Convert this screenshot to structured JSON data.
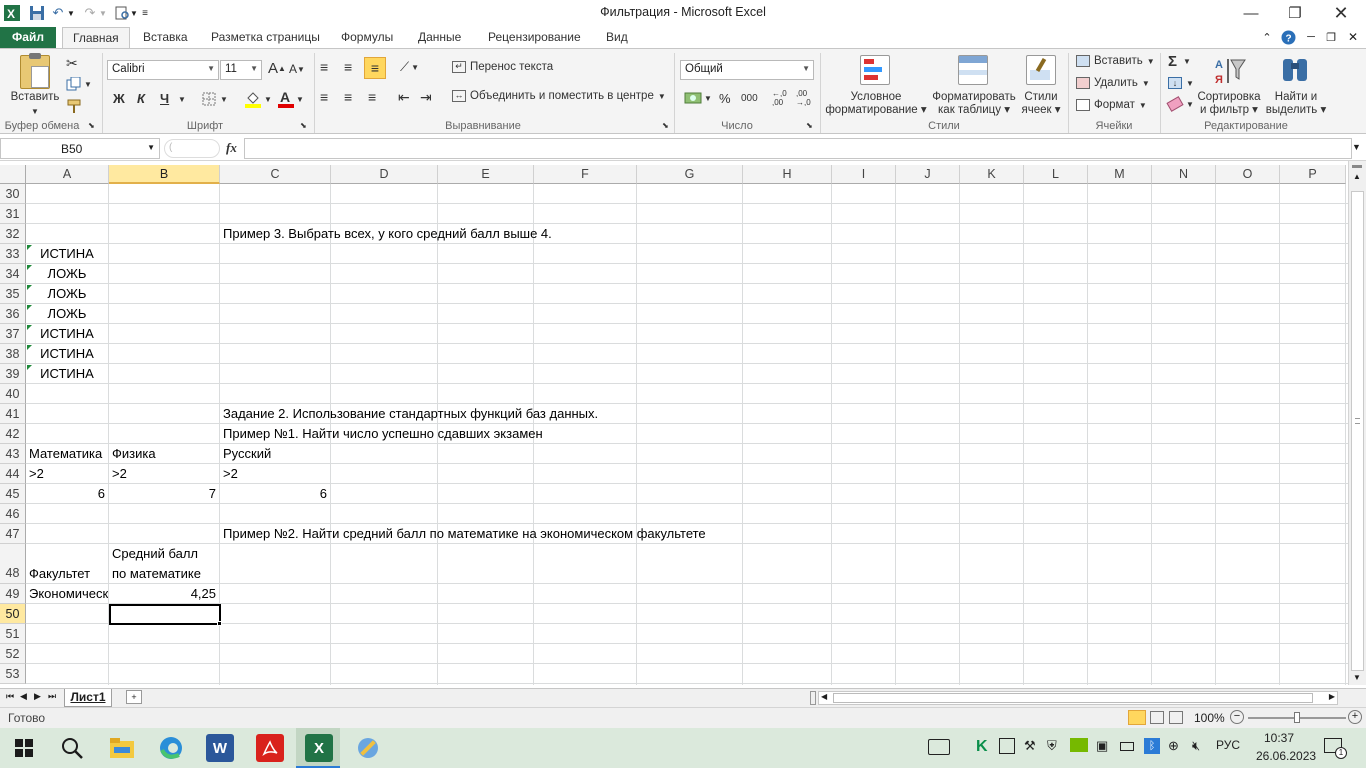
{
  "window": {
    "title": "Фильтрация  -  Microsoft Excel"
  },
  "qat": {
    "save": "save-icon",
    "undo": "undo-icon",
    "redo": "redo-icon",
    "print": "print-preview-icon"
  },
  "menu": {
    "file": "Файл",
    "tabs": [
      "Главная",
      "Вставка",
      "Разметка страницы",
      "Формулы",
      "Данные",
      "Рецензирование",
      "Вид"
    ]
  },
  "ribbon": {
    "clipboard": {
      "label": "Буфер обмена",
      "paste": "Вставить"
    },
    "font": {
      "label": "Шрифт",
      "name": "Calibri",
      "size": "11",
      "bold": "Ж",
      "italic": "К",
      "underline": "Ч",
      "grow": "A",
      "shrink": "A",
      "color": "A"
    },
    "alignment": {
      "label": "Выравнивание",
      "wrap": "Перенос текста",
      "merge": "Объединить и поместить в центре"
    },
    "number": {
      "label": "Число",
      "format": "Общий",
      "percent": "%",
      "thousands": "000",
      "inc": ",0\n,00",
      "dec": ",00\n,0"
    },
    "styles": {
      "label": "Стили",
      "conditional": "Условное\nформатирование",
      "astable": "Форматировать\nкак таблицу",
      "cellstyles": "Стили\nячеек"
    },
    "cells": {
      "label": "Ячейки",
      "insert": "Вставить",
      "delete": "Удалить",
      "format": "Формат"
    },
    "editing": {
      "label": "Редактирование",
      "sum": "Σ",
      "sort": "Сортировка\nи фильтр",
      "find": "Найти и\nвыделить"
    }
  },
  "formula_bar": {
    "name_box": "B50",
    "fx": "fx",
    "content": ""
  },
  "grid": {
    "columns": [
      "A",
      "B",
      "C",
      "D",
      "E",
      "F",
      "G",
      "H",
      "I",
      "J",
      "K",
      "L",
      "M",
      "N",
      "O",
      "P"
    ],
    "selected_column": "B",
    "selected_row": "50",
    "rows": [
      "30",
      "31",
      "32",
      "33",
      "34",
      "35",
      "36",
      "37",
      "38",
      "39",
      "40",
      "41",
      "42",
      "43",
      "44",
      "45",
      "46",
      "47",
      "48",
      "49",
      "50",
      "51",
      "52",
      "53"
    ],
    "cells": {
      "C32": "Пример 3. Выбрать всех, у кого средний балл выше 4.",
      "A33": "ИСТИНА",
      "A34": "ЛОЖЬ",
      "A35": "ЛОЖЬ",
      "A36": "ЛОЖЬ",
      "A37": "ИСТИНА",
      "A38": "ИСТИНА",
      "A39": "ИСТИНА",
      "C41": "Задание 2. Использование стандартных функций баз данных.",
      "C42": "Пример №1. Найти число успешно сдавших экзамен",
      "A43": "Математика",
      "B43": "Физика",
      "C43": "Русский",
      "A44": ">2",
      "B44": ">2",
      "C44": ">2",
      "A45": "6",
      "B45": "7",
      "C45": "6",
      "C47": "Пример №2. Найти средний балл по математике на экономическом факультете",
      "B48a": "Средний балл",
      "B48b": "по математике",
      "A48": "Факультет",
      "A49": "Экономический",
      "B49": "4,25"
    }
  },
  "sheets": {
    "active": "Лист1"
  },
  "status": {
    "ready": "Готово",
    "zoom": "100%"
  },
  "taskbar": {
    "lang": "РУС",
    "time": "10:37",
    "date": "26.06.2023"
  },
  "colors": {
    "accent": "#217346",
    "selection_header": "#ffe9a0",
    "taskbar": "#dbe9dc"
  }
}
